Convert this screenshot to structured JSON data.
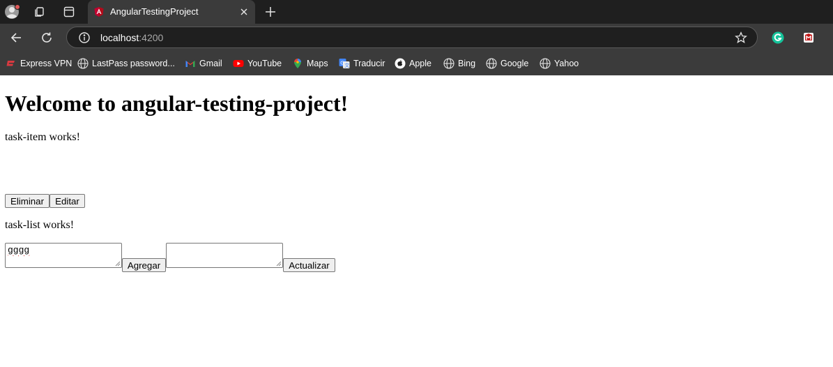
{
  "browser": {
    "tab": {
      "title": "AngularTestingProject"
    },
    "address": {
      "host": "localhost",
      "port": ":4200"
    },
    "bookmarks": [
      {
        "label": "Express VPN",
        "icon": "expressvpn-icon"
      },
      {
        "label": "LastPass password...",
        "icon": "globe-icon"
      },
      {
        "label": "Gmail",
        "icon": "gmail-icon"
      },
      {
        "label": "YouTube",
        "icon": "youtube-icon"
      },
      {
        "label": "Maps",
        "icon": "maps-icon"
      },
      {
        "label": "Traducir",
        "icon": "translate-icon"
      },
      {
        "label": "Apple",
        "icon": "apple-icon"
      },
      {
        "label": "Bing",
        "icon": "globe-icon"
      },
      {
        "label": "Google",
        "icon": "globe-icon"
      },
      {
        "label": "Yahoo",
        "icon": "globe-icon"
      }
    ],
    "colors": {
      "tabstrip": "#1f1f1f",
      "toolbar": "#3b3b3b",
      "omnibox": "#1f1f1f"
    }
  },
  "page": {
    "title": "Welcome to angular-testing-project!",
    "task_item": {
      "text": "task-item works!",
      "delete_label": "Eliminar",
      "edit_label": "Editar"
    },
    "task_list": {
      "text": "task-list works!",
      "add_input_value": "gggg",
      "add_label": "Agregar",
      "update_input_value": "",
      "update_label": "Actualizar"
    }
  }
}
